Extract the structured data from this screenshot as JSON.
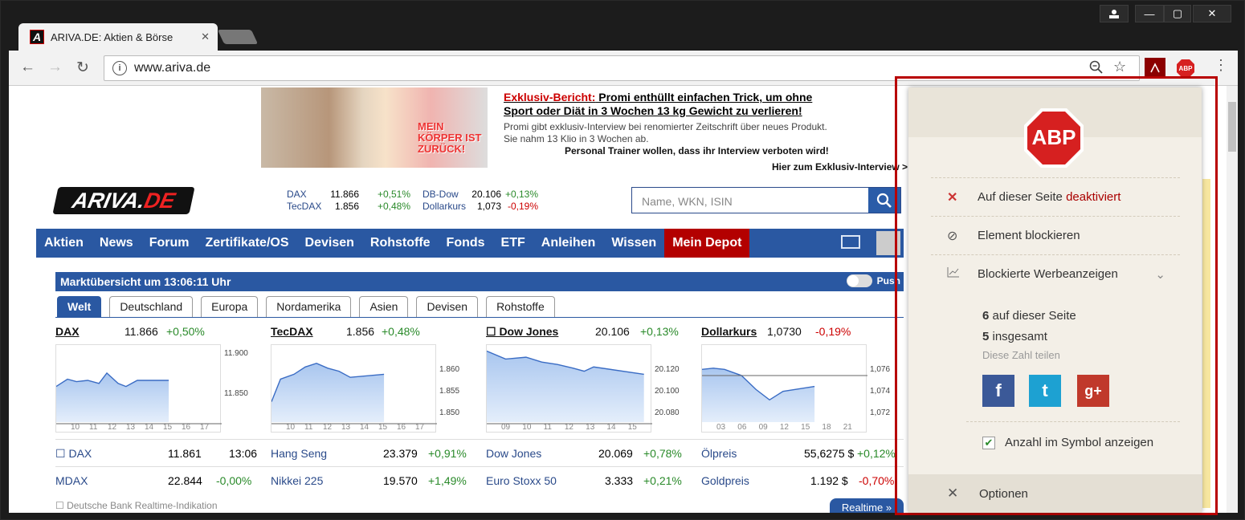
{
  "browser": {
    "tab_title": "ARIVA.DE: Aktien & Börse",
    "tab_favicon": "A",
    "url": "www.ariva.de",
    "window_min": "—",
    "window_max": "▢",
    "window_close": "✕"
  },
  "ad": {
    "headline_red": "Exklusiv-Bericht:",
    "headline_rest": " Promi enthüllt einfachen Trick, um ohne",
    "headline_line2": "Sport oder Diät in 3 Wochen 13 kg Gewicht zu verlieren!",
    "sub1": "Promi gibt exklusiv-Interview bei renomierter Zeitschrift über neues Produkt.",
    "sub2": "Sie nahm 13 Klio in 3 Wochen ab.",
    "personal": "Personal Trainer wollen, dass ihr Interview verboten wird!",
    "cta": "Hier zum Exklusiv-Interview >",
    "magazine_text": "MEIN KÖRPER IST ZURÜCK!"
  },
  "logo": {
    "ariva": "ARIVA.",
    "de": "DE"
  },
  "mini_quotes": [
    {
      "name": "DAX",
      "value": "11.866",
      "change": "+0,51%",
      "trend": "pos"
    },
    {
      "name": "DB-Dow",
      "value": "20.106",
      "change": "+0,13%",
      "trend": "pos"
    },
    {
      "name": "TecDAX",
      "value": "1.856",
      "change": "+0,48%",
      "trend": "pos"
    },
    {
      "name": "Dollarkurs",
      "value": "1,073",
      "change": "-0,19%",
      "trend": "neg"
    }
  ],
  "search": {
    "placeholder": "Name, WKN, ISIN"
  },
  "nav": [
    "Aktien",
    "News",
    "Forum",
    "Zertifikate/OS",
    "Devisen",
    "Rohstoffe",
    "Fonds",
    "ETF",
    "Anleihen",
    "Wissen",
    "Mein Depot"
  ],
  "market": {
    "title": "Marktübersicht um 13:06:11 Uhr",
    "push": "Push",
    "tabs": [
      "Welt",
      "Deutschland",
      "Europa",
      "Nordamerika",
      "Asien",
      "Devisen",
      "Rohstoffe"
    ]
  },
  "indices": [
    {
      "name": "DAX",
      "value": "11.866",
      "change": "+0,50%",
      "trend": "pos",
      "yticks": [
        "11.900",
        "11.850"
      ],
      "xticks": [
        "10",
        "11",
        "12",
        "13",
        "14",
        "15",
        "16",
        "17"
      ]
    },
    {
      "name": "TecDAX",
      "value": "1.856",
      "change": "+0,48%",
      "trend": "pos",
      "yticks": [
        "1.860",
        "1.855",
        "1.850"
      ],
      "xticks": [
        "10",
        "11",
        "12",
        "13",
        "14",
        "15",
        "16",
        "17"
      ]
    },
    {
      "name": "Dow Jones",
      "value": "20.106",
      "change": "+0,13%",
      "trend": "pos",
      "yticks": [
        "20.120",
        "20.100",
        "20.080"
      ],
      "xticks": [
        "09",
        "10",
        "11",
        "12",
        "13",
        "14",
        "15"
      ]
    },
    {
      "name": "Dollarkurs",
      "value": "1,0730",
      "change": "-0,19%",
      "trend": "neg",
      "yticks": [
        "1,076",
        "1,074",
        "1,072"
      ],
      "xticks": [
        "03",
        "06",
        "09",
        "12",
        "15",
        "18",
        "21"
      ]
    }
  ],
  "quote_rows": [
    [
      {
        "name": "DAX",
        "value": "11.861",
        "extra": "13:06"
      },
      {
        "name": "Hang Seng",
        "value": "23.379",
        "change": "+0,91%",
        "trend": "pos"
      },
      {
        "name": "Dow Jones",
        "value": "20.069",
        "change": "+0,78%",
        "trend": "pos"
      },
      {
        "name": "Ölpreis",
        "value": "55,6275 $",
        "change": "+0,12%",
        "trend": "pos"
      }
    ],
    [
      {
        "name": "MDAX",
        "value": "22.844",
        "change": "-0,00%",
        "trend": "pos"
      },
      {
        "name": "Nikkei 225",
        "value": "19.570",
        "change": "+1,49%",
        "trend": "pos"
      },
      {
        "name": "Euro Stoxx 50",
        "value": "3.333",
        "change": "+0,21%",
        "trend": "pos"
      },
      {
        "name": "Goldpreis",
        "value": "1.192 $",
        "change": "-0,70%",
        "trend": "neg"
      }
    ]
  ],
  "footnote": "Deutsche Bank Realtime-Indikation",
  "realtime": "Realtime »",
  "abp": {
    "logo": "ABP",
    "disabled_prefix": "Auf dieser Seite ",
    "disabled_word": "deaktiviert",
    "block_element": "Element blockieren",
    "blocked_ads": "Blockierte Werbeanzeigen",
    "on_page_count": "6",
    "on_page_label": " auf dieser Seite",
    "total_count": "5",
    "total_label": " insgesamt",
    "share": "Diese Zahl teilen",
    "facebook": "f",
    "twitter": "t",
    "gplus": "g+",
    "show_count": "Anzahl im Symbol anzeigen",
    "options": "Optionen"
  },
  "colors": {
    "nav_blue": "#2a58a2",
    "depot_red": "#b30000",
    "positive": "#2a8a2a",
    "negative": "#cc0000"
  }
}
